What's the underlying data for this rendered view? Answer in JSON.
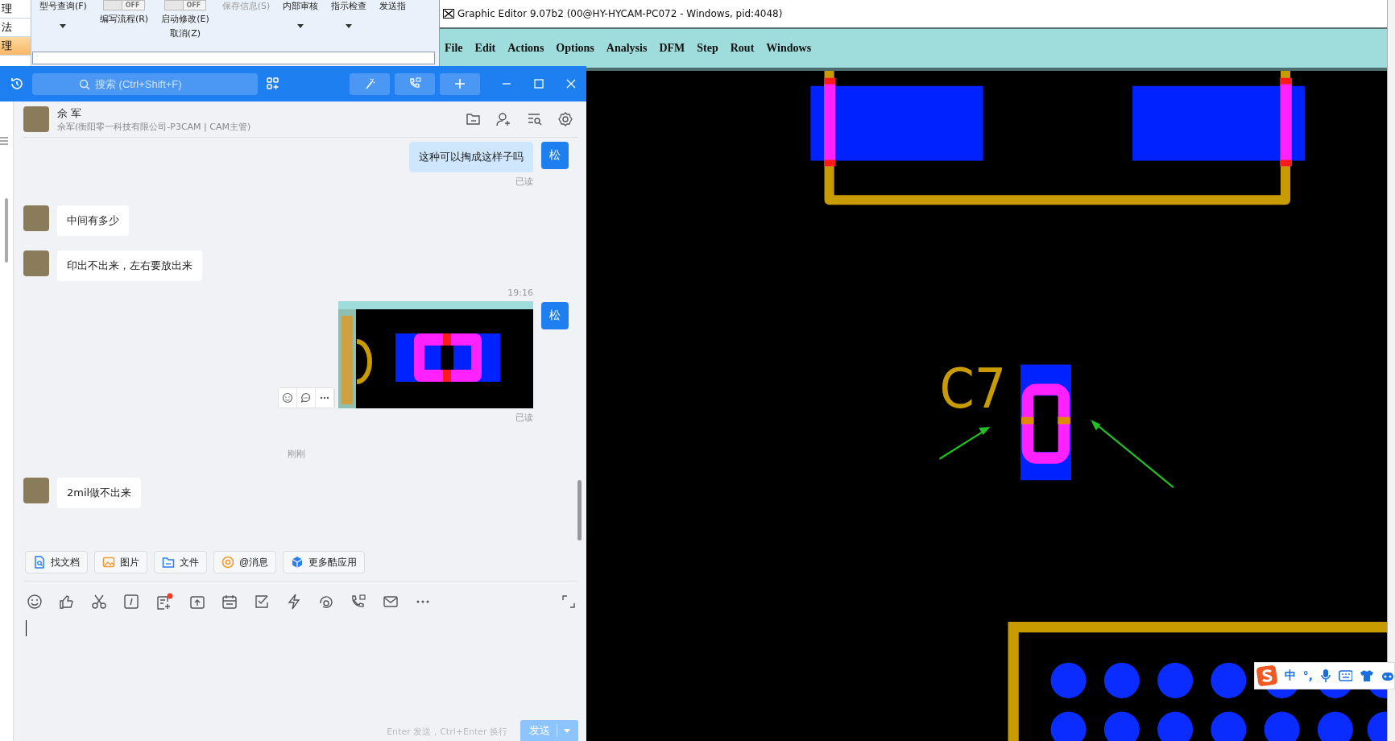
{
  "background_app": {
    "sidebar_items": [
      {
        "label": "理",
        "selected": false
      },
      {
        "label": "法",
        "selected": false
      },
      {
        "label": "理",
        "selected": true
      }
    ],
    "ribbon": [
      {
        "kind": "dropdown",
        "label": "型号查询(F)",
        "disabled": false
      },
      {
        "kind": "toggle",
        "toggle_text": "OFF",
        "on": false,
        "label": "编写流程(R)",
        "disabled": false
      },
      {
        "kind": "toggle",
        "toggle_text": "OFF",
        "on": false,
        "label": "启动修改(E)",
        "sublabel": "取消(Z)",
        "disabled": false
      },
      {
        "kind": "plain",
        "label": "保存信息(S)",
        "disabled": true
      },
      {
        "kind": "dropdown",
        "label": "内部审核",
        "disabled": false
      },
      {
        "kind": "dropdown",
        "label": "指示检查",
        "disabled": false
      },
      {
        "kind": "plain",
        "label": "发送指",
        "disabled": false
      }
    ]
  },
  "editor": {
    "title": "Graphic Editor 9.07b2 (00@HY-HYCAM-PC072 - Windows, pid:4048)",
    "menu": [
      "File",
      "Edit",
      "Actions",
      "Options",
      "Analysis",
      "DFM",
      "Step",
      "Rout",
      "Windows"
    ],
    "canvas": {
      "designator": "C7"
    }
  },
  "ime_bar": {
    "items": [
      "中",
      "°,"
    ]
  },
  "chat": {
    "search": {
      "placeholder": "搜索 (Ctrl+Shift+F)"
    },
    "contact": {
      "name": "佘 军",
      "subtitle": "佘军(衡阳零一科技有限公司-P3CAM | CAM主管)"
    },
    "messages": [
      {
        "kind": "outgoing",
        "text": "这种可以掏成这样子吗",
        "avatar_text": "松",
        "status": "已读"
      },
      {
        "kind": "incoming",
        "text": "中间有多少"
      },
      {
        "kind": "incoming",
        "text": "印出不出来，左右要放出来"
      },
      {
        "kind": "outgoing_image",
        "time": "19:16",
        "avatar_text": "松",
        "status": "已读"
      },
      {
        "kind": "divider",
        "text": "刚刚"
      },
      {
        "kind": "incoming",
        "text": "2mil做不出来"
      }
    ],
    "quick_actions": [
      {
        "kind": "doc",
        "label": "找文档"
      },
      {
        "kind": "image",
        "label": "图片"
      },
      {
        "kind": "folder",
        "label": "文件"
      },
      {
        "kind": "mention",
        "label": "@消息"
      },
      {
        "kind": "apps",
        "label": "更多酷应用"
      }
    ],
    "composer": {
      "notes_badge": true,
      "hint": "Enter 发送，Ctrl+Enter 换行",
      "send_label": "发送",
      "send_disabled": true
    }
  }
}
